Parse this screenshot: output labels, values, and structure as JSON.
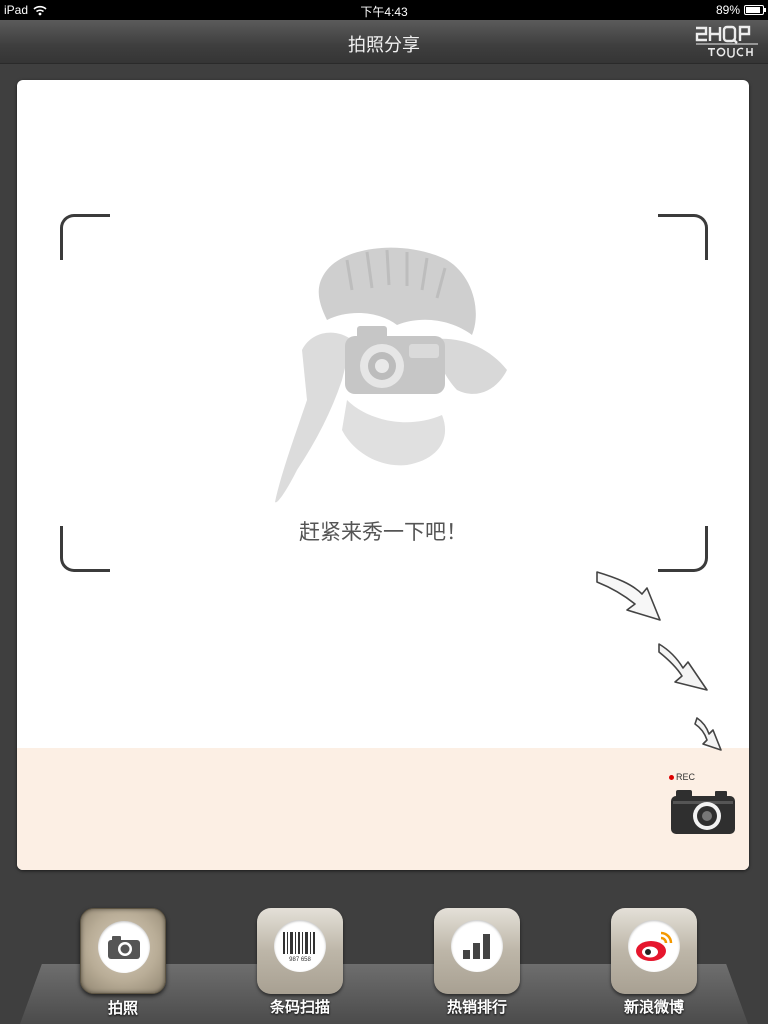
{
  "status_bar": {
    "device": "iPad",
    "time": "下午4:43",
    "battery": "89%"
  },
  "header": {
    "title": "拍照分享",
    "brand_logo_text": "SHOP TOUCH"
  },
  "viewfinder": {
    "prompt": "赶紧来秀一下吧！",
    "rec_label": "REC"
  },
  "tabs": [
    {
      "label": "拍照",
      "icon": "camera-icon",
      "active": true
    },
    {
      "label": "条码扫描",
      "icon": "barcode-icon",
      "barcode_digits": "987 658",
      "active": false
    },
    {
      "label": "热销排行",
      "icon": "bar-chart-icon",
      "active": false
    },
    {
      "label": "新浪微博",
      "icon": "weibo-icon",
      "active": false
    }
  ],
  "colors": {
    "accent_band": "#fcefe4",
    "background": "#3f3f3f",
    "weibo_red": "#e6162d"
  }
}
